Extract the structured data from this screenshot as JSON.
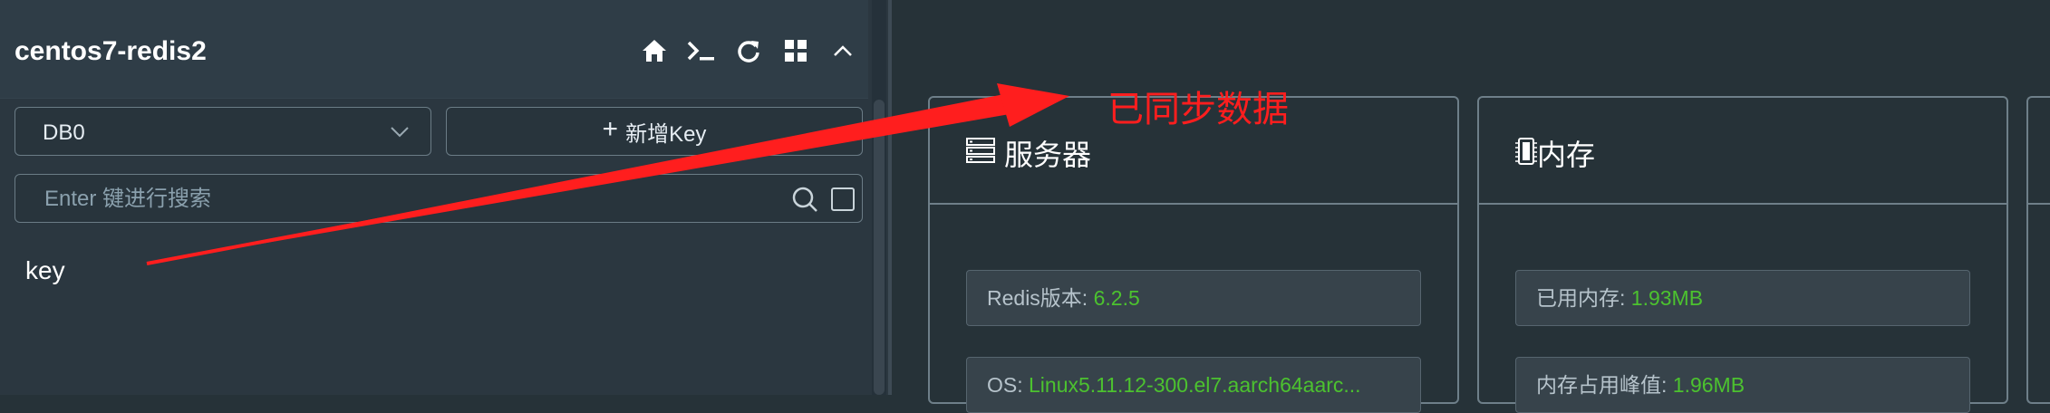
{
  "sidebar": {
    "connection_name": "centos7-redis2",
    "icons": [
      "home-icon",
      "terminal-icon",
      "refresh-icon",
      "grid-icon",
      "collapse-icon"
    ],
    "db_select": {
      "value": "DB0"
    },
    "new_key_label": "新增Key",
    "search": {
      "placeholder": "Enter 键进行搜索"
    },
    "keys": [
      "key"
    ]
  },
  "cards": {
    "server": {
      "title": "服务器",
      "rows": [
        {
          "label": "Redis版本: ",
          "value": "6.2.5"
        },
        {
          "label": "OS: ",
          "value": "Linux5.11.12-300.el7.aarch64aarc..."
        }
      ]
    },
    "memory": {
      "title": "内存",
      "rows": [
        {
          "label": "已用内存: ",
          "value": "1.93MB"
        },
        {
          "label": "内存占用峰值: ",
          "value": "1.96MB"
        }
      ]
    }
  },
  "annotation": {
    "text": "已同步数据",
    "color": "#ff1e1e"
  },
  "colors": {
    "accent_value": "#4cc22f",
    "background": "#263238"
  }
}
